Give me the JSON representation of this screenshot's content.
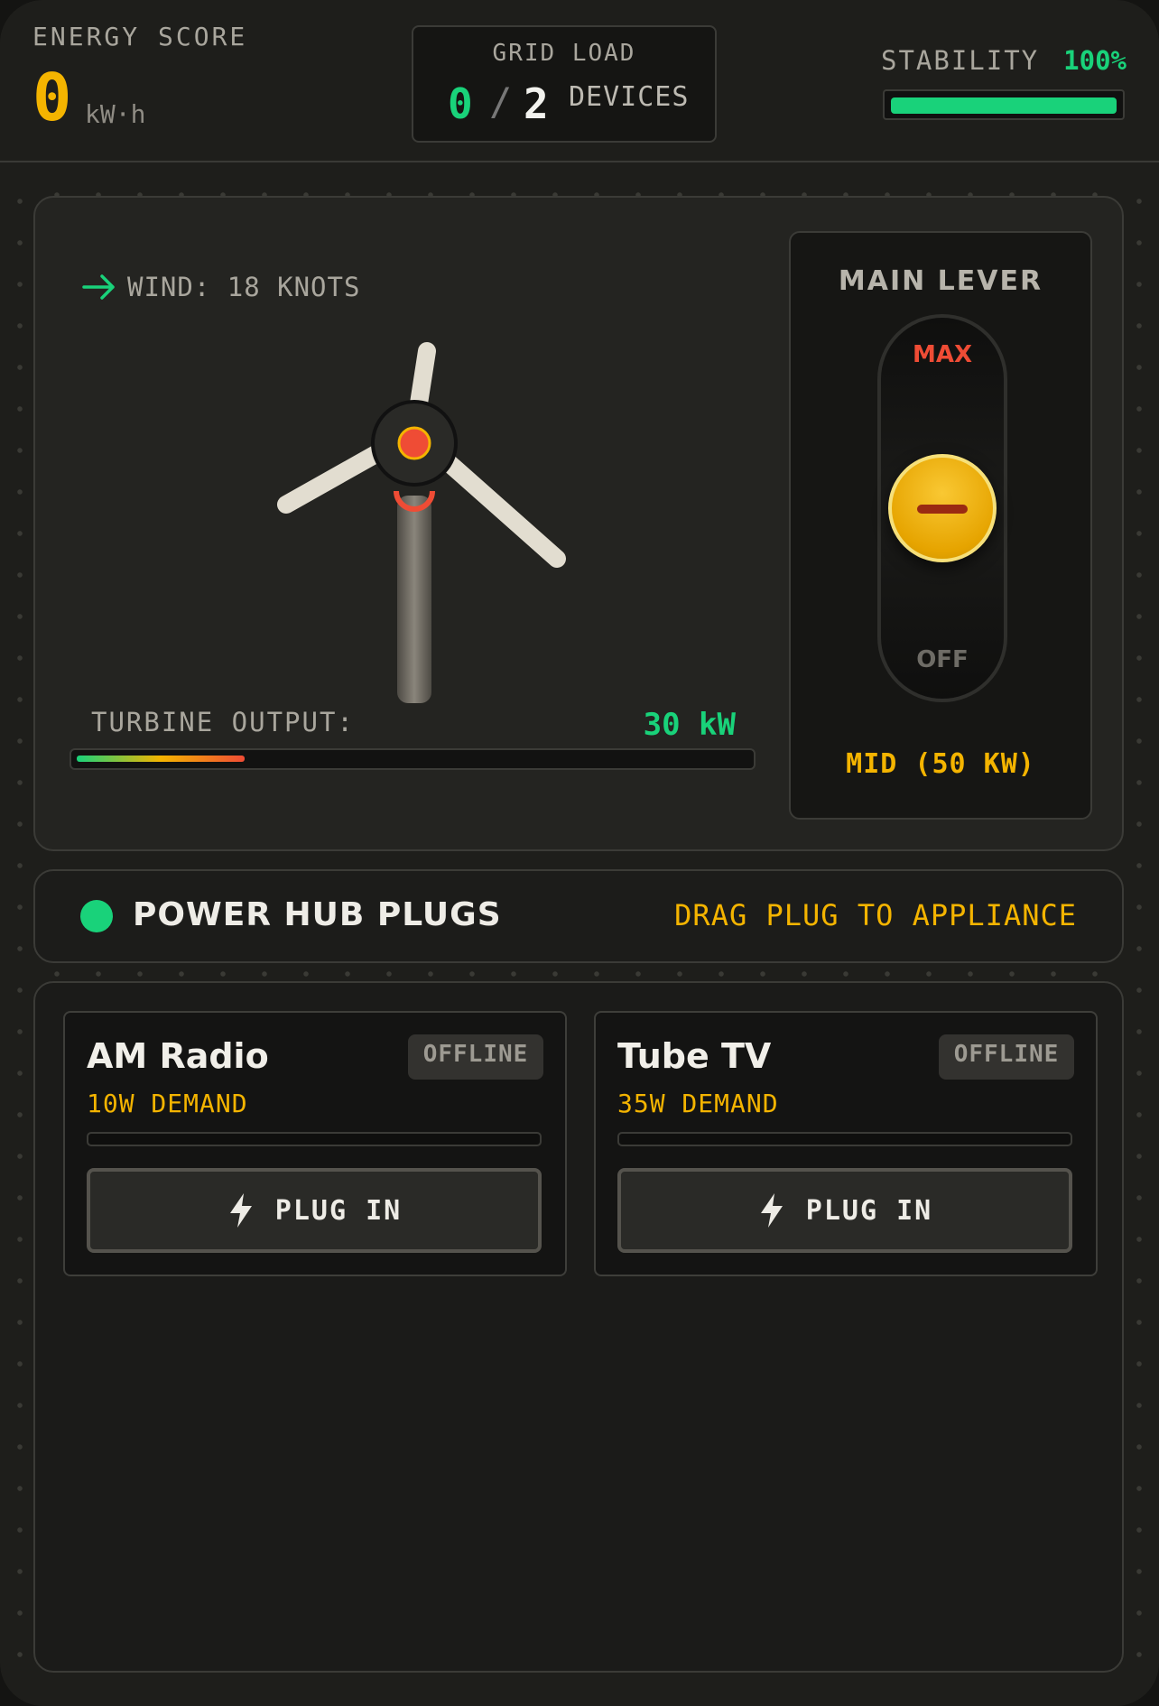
{
  "header": {
    "energy_label": "ENERGY SCORE",
    "energy_value": "0",
    "energy_unit": "kW·h",
    "grid_label": "GRID LOAD",
    "grid_current": "0",
    "grid_slash": "/",
    "grid_total": "2",
    "grid_devices": "DEVICES",
    "stability_label": "STABILITY",
    "stability_value": "100%",
    "stability_level": 1.0
  },
  "turbine": {
    "wind_text": "WIND: 18 KNOTS",
    "output_label": "TURBINE OUTPUT:",
    "output_value": "30 kW",
    "output_level": 0.25
  },
  "lever": {
    "title": "MAIN LEVER",
    "max_label": "MAX",
    "off_label": "OFF",
    "state_label": "MID (50 KW)",
    "position": 0.5
  },
  "hub": {
    "title": "POWER HUB PLUGS",
    "hint": "DRAG PLUG TO APPLIANCE"
  },
  "appliances": [
    {
      "name": "AM Radio",
      "demand": "10W DEMAND",
      "status": "OFFLINE",
      "button": "PLUG IN",
      "level": 0
    },
    {
      "name": "Tube TV",
      "demand": "35W DEMAND",
      "status": "OFFLINE",
      "button": "PLUG IN",
      "level": 0
    }
  ],
  "colors": {
    "accent_green": "#19d27a",
    "accent_gold": "#f4b400",
    "accent_red": "#ef4c35"
  }
}
